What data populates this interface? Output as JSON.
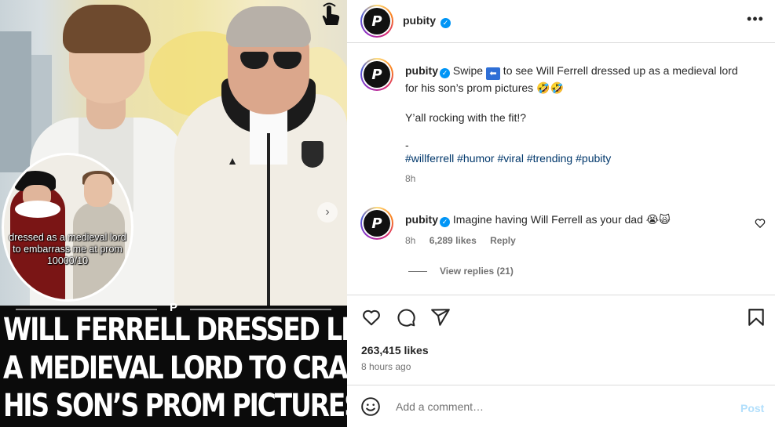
{
  "media": {
    "inset_caption": [
      "dressed as a medieval lord",
      "to embarrass me at prom",
      "10000/10"
    ],
    "headline": [
      "WILL FERRELL DRESSED LIKE",
      "A MEDIEVAL LORD TO CRASH",
      "HIS SON’S PROM PICTURES"
    ],
    "logo_glyph": "P",
    "next_glyph": "›"
  },
  "header": {
    "username": "pubity",
    "avatar_glyph": "P",
    "more_glyph": "•••"
  },
  "caption": {
    "username": "pubity",
    "text_before": " Swipe ",
    "swipe_glyph": "⬅",
    "text_after": " to see Will Ferrell dressed up as a medieval lord for his son’s prom pictures 🤣🤣",
    "line2": "Y’all rocking with the fit!?",
    "line3": "-",
    "tags": [
      "#willferrell",
      "#humor",
      "#viral",
      "#trending",
      "#pubity"
    ],
    "age": "8h"
  },
  "comment": {
    "username": "pubity",
    "text": "Imagine having Will Ferrell as your dad 😭🙀",
    "age": "8h",
    "likes": "6,289 likes",
    "reply": "Reply",
    "view_replies": "View replies (21)"
  },
  "post": {
    "likes": "263,415 likes",
    "time": "8 hours ago",
    "comment_placeholder": "Add a comment…",
    "post_label": "Post"
  },
  "colors": {
    "verified": "#0095f6",
    "link": "#00376b",
    "muted": "#737373",
    "post_disabled": "#b2dffc"
  }
}
